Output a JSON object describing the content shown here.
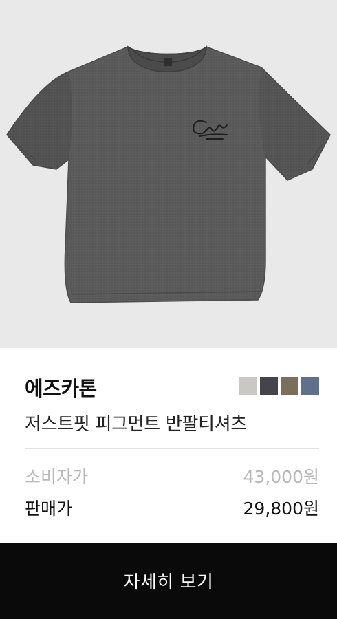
{
  "product": {
    "image_icon": "tshirt-image",
    "brand": "에즈카톤",
    "name": "저스트핏 피그먼트 반팔티셔츠",
    "colors": [
      "#c9c8c3",
      "#45444a",
      "#7a6f5b",
      "#5f6f8c"
    ]
  },
  "pricing": {
    "retail_label": "소비자가",
    "retail_price": "43,000원",
    "sale_label": "판매가",
    "sale_price": "29,800원"
  },
  "cta": {
    "label": "자세히 보기"
  }
}
